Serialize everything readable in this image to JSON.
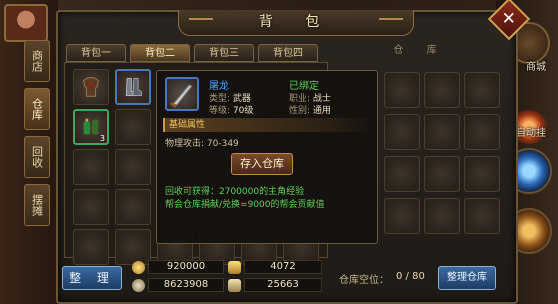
{
  "window": {
    "title": "背 包"
  },
  "side_tabs": [
    {
      "label": "商店"
    },
    {
      "label": "仓库"
    },
    {
      "label": "回收"
    },
    {
      "label": "摆摊"
    }
  ],
  "bag_tabs": [
    {
      "label": "背包一",
      "active": false
    },
    {
      "label": "背包二",
      "active": true
    },
    {
      "label": "背包三",
      "active": false
    },
    {
      "label": "背包四",
      "active": false
    }
  ],
  "storage": {
    "header": "仓 库",
    "space_label": "仓库空位：",
    "space_value": "0 / 80",
    "sort_button": "整理仓库"
  },
  "bag": {
    "sort_button": "整 理",
    "first_slot_count": "3"
  },
  "tooltip": {
    "item_name": "屠龙",
    "type_key": "类型:",
    "type_value": "武器",
    "level_key": "等级:",
    "level_value": "70级",
    "bound": "已绑定",
    "job_key": "职业:",
    "job_value": "战士",
    "gender_key": "性别:",
    "gender_value": "通用",
    "section_title": "基础属性",
    "attack": "物理攻击: 70-349",
    "deposit_button": "存入仓库",
    "recycle_text": "回收可获得：2700000的主角经验",
    "guild_text": "帮会仓库捐献/兑换=9000的帮会贡献值"
  },
  "currency": {
    "gold": "920000",
    "ingot": "4072",
    "bound_gold": "8623908",
    "bound_ingot": "25663"
  },
  "hud": {
    "label_shop": "商城",
    "label_auto": "自动挂"
  },
  "colors": {
    "accent_gold": "#c89a4a",
    "item_name_blue": "#49a6ff",
    "bound_green": "#5ed05e",
    "button_blue": "#3a6aa0"
  }
}
